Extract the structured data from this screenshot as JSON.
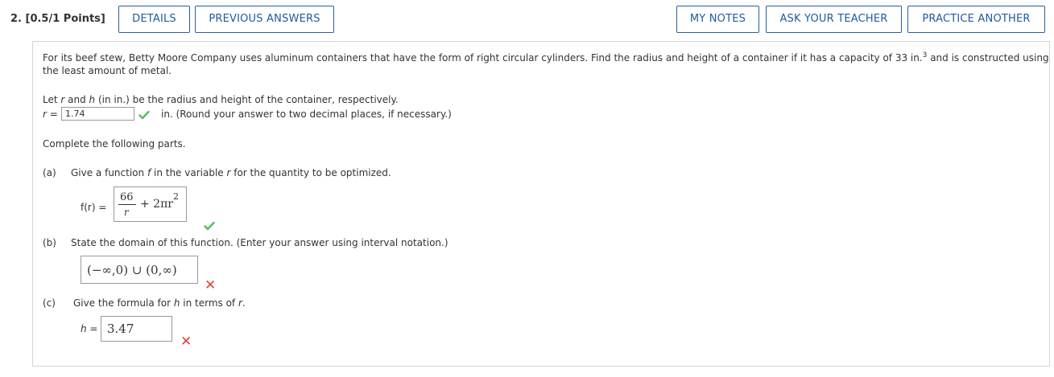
{
  "header": {
    "question_label": "2. [0.5/1 Points]",
    "buttons": {
      "details": "DETAILS",
      "previous_answers": "PREVIOUS ANSWERS",
      "my_notes": "MY NOTES",
      "ask_teacher": "ASK YOUR TEACHER",
      "practice_another": "PRACTICE ANOTHER"
    }
  },
  "problem": {
    "line1": "For its beef stew, Betty Moore Company uses aluminum containers that have the form of right circular cylinders. Find the radius and height of a container if it has a capacity of 33 in.",
    "line1_sup": "3",
    "line1_end": " and is constructed using",
    "line2": "the least amount of metal."
  },
  "setup": {
    "let_a": "Let ",
    "r": "r",
    "let_b": " and ",
    "h": "h",
    "let_c": " (in in.) be the radius and height of the container, respectively.",
    "r_eq": "r =",
    "r_value": "1.74",
    "r_hint": "in. (Round your answer to two decimal places, if necessary.)"
  },
  "complete": "Complete the following parts.",
  "part_a": {
    "label": "(a)",
    "q1": "Give a function ",
    "f": "f",
    "q2": " in the variable ",
    "r": "r",
    "q3": " for the quantity to be optimized.",
    "f_label": "f(r) =",
    "numerator": "66",
    "denominator": "r",
    "plus_term": "+ 2πr",
    "exponent": "2",
    "status": "correct"
  },
  "part_b": {
    "label": "(b)",
    "question": "State the domain of this function. (Enter your answer using interval notation.)",
    "answer": "(−∞,0) ∪ (0,∞)",
    "status": "incorrect"
  },
  "part_c": {
    "label": "(c)",
    "q1": "Give the formula for ",
    "h": "h",
    "q2": " in terms of ",
    "r": "r",
    "q3": ".",
    "h_eq": "h =",
    "answer": "3.47",
    "status": "incorrect"
  },
  "colors": {
    "accent": "#1f5aa0",
    "correct": "#5cb85c",
    "incorrect": "#e0413a"
  }
}
